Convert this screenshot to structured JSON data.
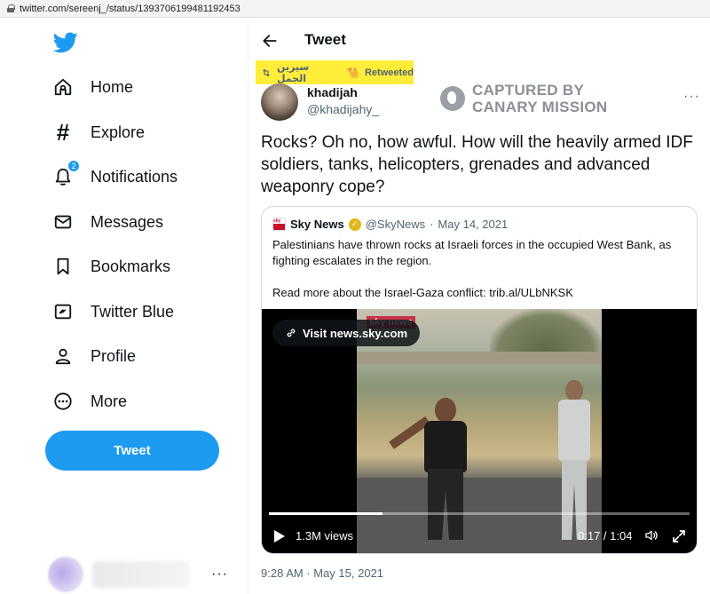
{
  "browser": {
    "url": "twitter.com/sereenj_/status/1393706199481192453"
  },
  "sidebar": {
    "items": [
      {
        "label": "Home",
        "icon": "home-icon"
      },
      {
        "label": "Explore",
        "icon": "hashtag-icon"
      },
      {
        "label": "Notifications",
        "icon": "bell-icon",
        "badge": "2"
      },
      {
        "label": "Messages",
        "icon": "envelope-icon"
      },
      {
        "label": "Bookmarks",
        "icon": "bookmark-icon"
      },
      {
        "label": "Twitter Blue",
        "icon": "twitter-blue-icon"
      },
      {
        "label": "Profile",
        "icon": "person-icon"
      },
      {
        "label": "More",
        "icon": "more-circle-icon"
      }
    ],
    "tweet_button": "Tweet",
    "account_menu": "···"
  },
  "header": {
    "title": "Tweet"
  },
  "tweet": {
    "retweeted_by": "سيرين الجمل",
    "retweeted_emoji": "🐪",
    "retweeted_label": "Retweeted",
    "author_name": "khadijah",
    "author_handle": "@khadijahy_",
    "watermark_line1": "CAPTURED BY",
    "watermark_line2": "CANARY MISSION",
    "more": "···",
    "text": "Rocks? Oh no, how awful. How will the heavily armed IDF soldiers, tanks, helicopters, grenades and advanced weaponry cope?",
    "timestamp": "9:28 AM · May 15, 2021"
  },
  "quote": {
    "logo_text": "sky news",
    "name": "Sky News",
    "handle": "@SkyNews",
    "separator": "·",
    "date": "May 14, 2021",
    "body_line1": "Palestinians have thrown rocks at Israeli forces in the occupied West Bank, as fighting escalates in the region.",
    "body_line2": "Read more about the Israel-Gaza conflict: trib.al/ULbNKSK",
    "video": {
      "watermark": "sky news",
      "visit_label": "Visit news.sky.com",
      "views": "1.3M views",
      "time": "0:17 / 1:04",
      "progress": 0.27
    }
  },
  "colors": {
    "accent": "#1d9bf0",
    "highlight": "#ffed3a",
    "muted": "#536471"
  }
}
